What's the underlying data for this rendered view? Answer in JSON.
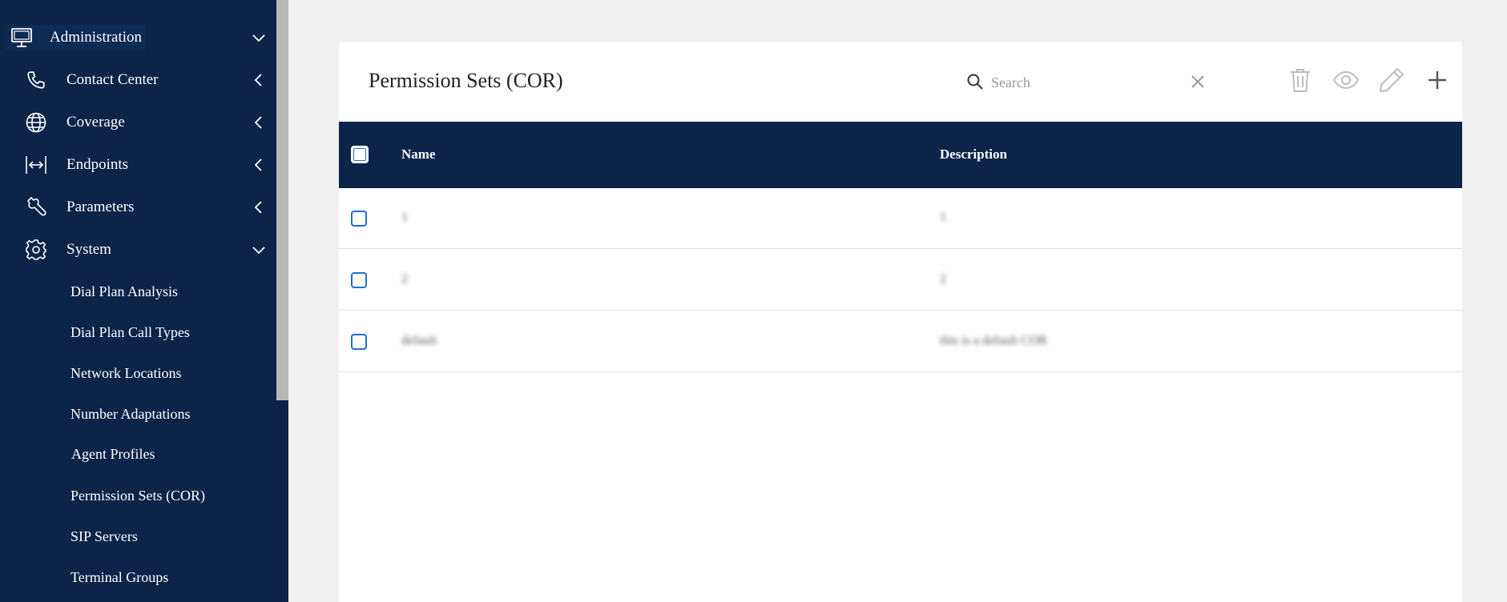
{
  "sidebar": {
    "items": [
      {
        "label": "Administration",
        "icon": "monitor-icon",
        "chevron": "chevron-down-icon"
      },
      {
        "label": "Contact Center",
        "icon": "phone-icon",
        "chevron": "chevron-left-icon"
      },
      {
        "label": "Coverage",
        "icon": "globe-icon",
        "chevron": "chevron-left-icon"
      },
      {
        "label": "Endpoints",
        "icon": "endpoints-icon",
        "chevron": "chevron-left-icon"
      },
      {
        "label": "Parameters",
        "icon": "wrench-icon",
        "chevron": "chevron-left-icon"
      },
      {
        "label": "System",
        "icon": "gear-icon",
        "chevron": "chevron-down-icon"
      }
    ],
    "sub_items": [
      "Dial Plan Analysis",
      "Dial Plan Call Types",
      "Network Locations",
      "Number Adaptations",
      "Agent Profiles",
      "Permission Sets (COR)",
      "SIP Servers",
      "Terminal Groups"
    ]
  },
  "main": {
    "title": "Permission Sets (COR)",
    "search": {
      "placeholder": "Search",
      "value": ""
    },
    "toolbar": [
      "delete-icon",
      "view-icon",
      "edit-icon",
      "add-icon"
    ],
    "table": {
      "columns": [
        "Name",
        "Description"
      ],
      "rows": [
        {
          "name": "1",
          "description": "1"
        },
        {
          "name": "2",
          "description": "2"
        },
        {
          "name": "default",
          "description": "this is a default COR"
        }
      ]
    }
  },
  "colors": {
    "sidebar_bg": "#0b2448",
    "table_header_bg": "#0b2448",
    "page_bg": "#f0f0f0",
    "checkbox_border": "#1e6fd1"
  }
}
